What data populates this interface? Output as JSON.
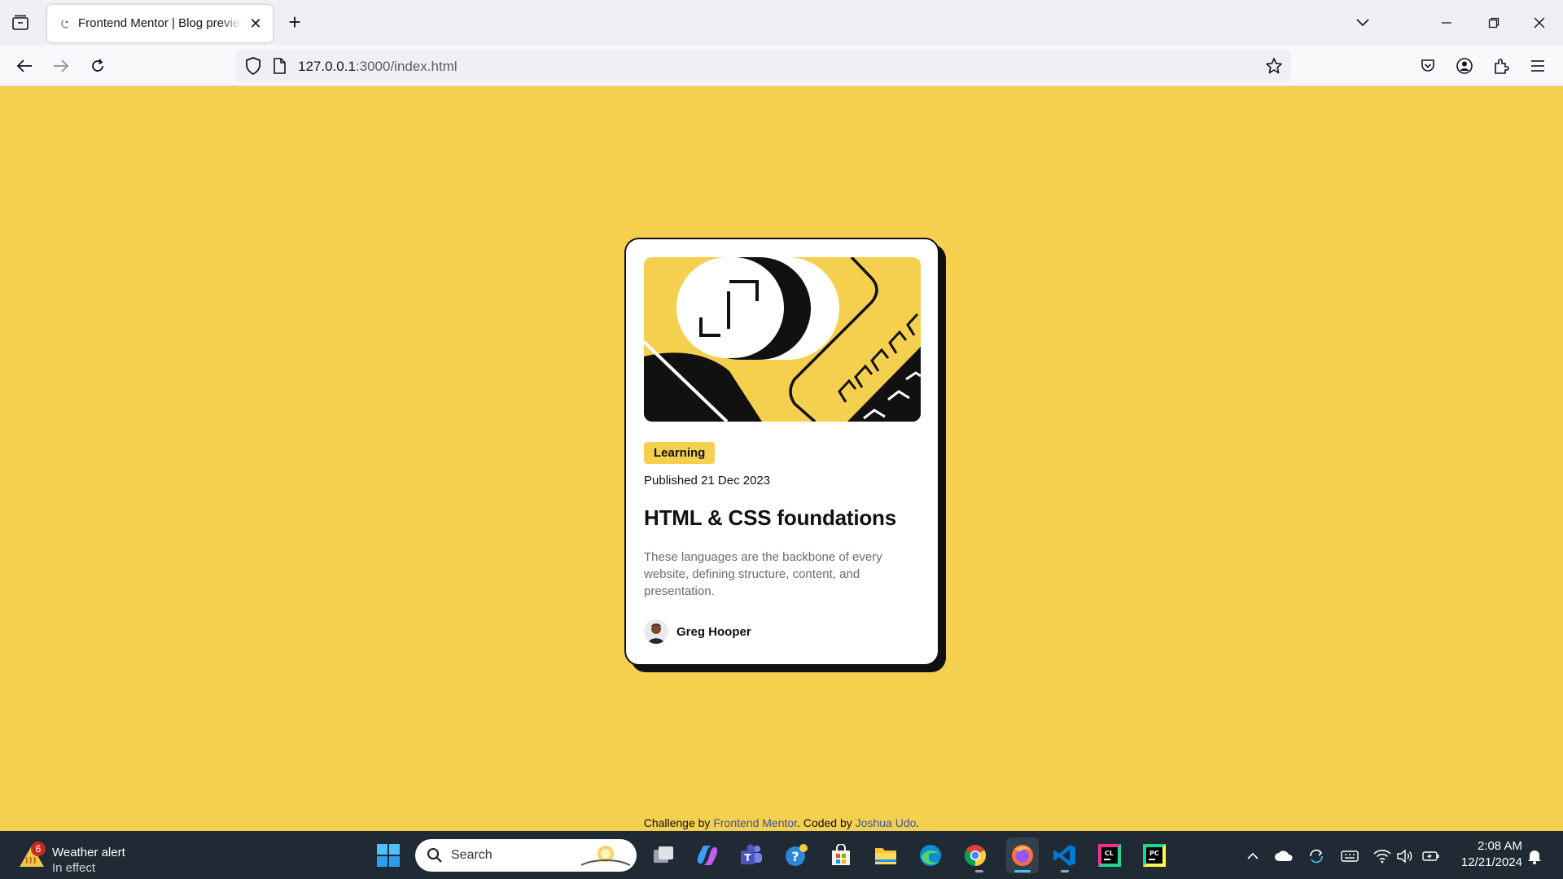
{
  "browser": {
    "tab_title": "Frontend Mentor | Blog preview card",
    "tab_close": "✕",
    "new_tab": "+",
    "url_host": "127.0.0.1",
    "url_path": ":3000/index.html"
  },
  "card": {
    "tag": "Learning",
    "date": "Published 21 Dec 2023",
    "title": "HTML & CSS foundations",
    "description": "These languages are the backbone of every website, defining structure, content, and presentation.",
    "author": "Greg Hooper"
  },
  "attribution": {
    "prefix": "Challenge by ",
    "link1": "Frontend Mentor",
    "middle": ". Coded by ",
    "link2": "Joshua Udo",
    "suffix": "."
  },
  "taskbar": {
    "weather_title": "Weather alert",
    "weather_status": "In effect",
    "weather_badge": "6",
    "search_placeholder": "Search",
    "time": "2:08 AM",
    "date": "12/21/2024"
  },
  "colors": {
    "page_background": "#f4d04e",
    "card_shadow": "#111111",
    "link": "#3e52a3",
    "taskbar": "#1f2a35"
  }
}
